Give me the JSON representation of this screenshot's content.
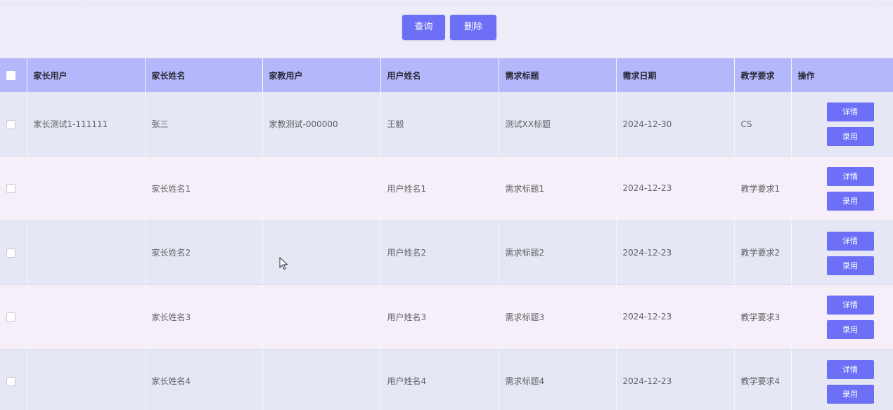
{
  "toolbar": {
    "query_label": "查询",
    "delete_label": "删除"
  },
  "table": {
    "columns": [
      "家长用户",
      "家长姓名",
      "家教用户",
      "用户姓名",
      "需求标题",
      "需求日期",
      "教学要求",
      "操作"
    ],
    "rows": [
      {
        "parent_user": "家长测试1-111111",
        "parent_name": "张三",
        "tutor_user": "家教测试-000000",
        "user_name": "王毅",
        "title": "测试XX标题",
        "date": "2024-12-30",
        "requirement": "CS"
      },
      {
        "parent_user": "",
        "parent_name": "家长姓名1",
        "tutor_user": "",
        "user_name": "用户姓名1",
        "title": "需求标题1",
        "date": "2024-12-23",
        "requirement": "教学要求1"
      },
      {
        "parent_user": "",
        "parent_name": "家长姓名2",
        "tutor_user": "",
        "user_name": "用户姓名2",
        "title": "需求标题2",
        "date": "2024-12-23",
        "requirement": "教学要求2"
      },
      {
        "parent_user": "",
        "parent_name": "家长姓名3",
        "tutor_user": "",
        "user_name": "用户姓名3",
        "title": "需求标题3",
        "date": "2024-12-23",
        "requirement": "教学要求3"
      },
      {
        "parent_user": "",
        "parent_name": "家长姓名4",
        "tutor_user": "",
        "user_name": "用户姓名4",
        "title": "需求标题4",
        "date": "2024-12-23",
        "requirement": "教学要求4"
      }
    ],
    "row_actions": {
      "detail_label": "详情",
      "hire_label": "录用"
    }
  },
  "colors": {
    "accent": "#6d6ff6",
    "header_bg": "#b4b8fb",
    "row_odd": "#e6e7f4",
    "row_even": "#f6eef8"
  }
}
